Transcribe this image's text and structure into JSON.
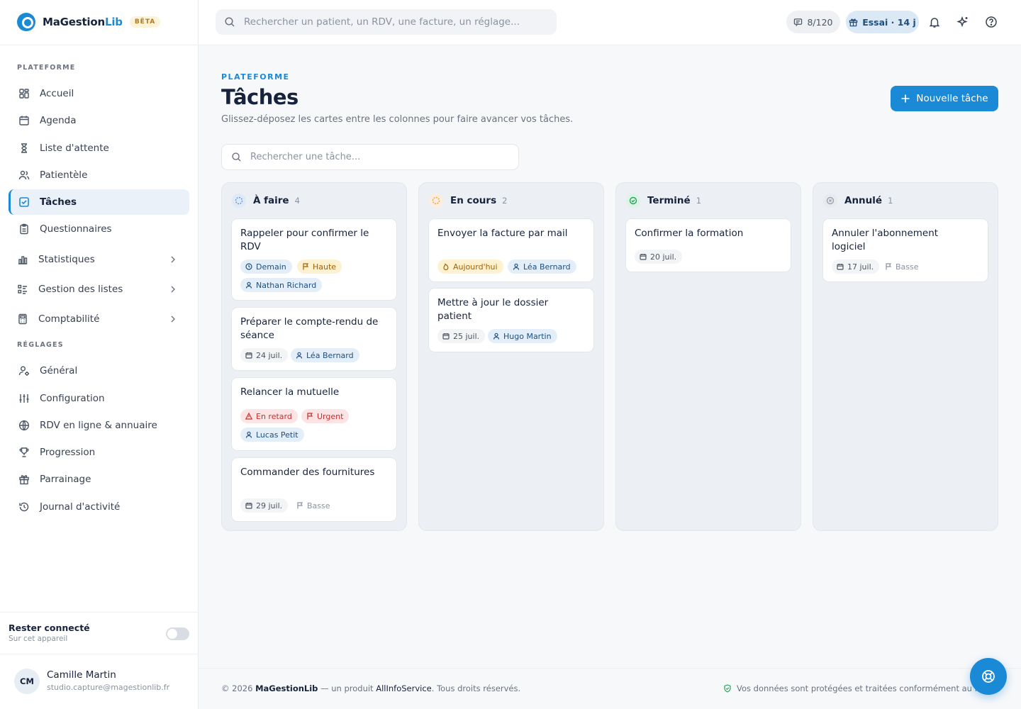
{
  "brand": {
    "name_main": "MaGestion",
    "name_accent": "Lib",
    "badge": "BÊTA"
  },
  "sidebar": {
    "section_platform": "PLATEFORME",
    "section_settings": "RÉGLAGES",
    "items": [
      {
        "label": "Accueil",
        "icon": "grid-icon"
      },
      {
        "label": "Agenda",
        "icon": "calendar-icon"
      },
      {
        "label": "Liste d'attente",
        "icon": "hourglass-icon"
      },
      {
        "label": "Patientèle",
        "icon": "users-icon"
      },
      {
        "label": "Tâches",
        "icon": "checkbox-icon",
        "active": true
      },
      {
        "label": "Questionnaires",
        "icon": "clipboard-icon"
      },
      {
        "label": "Statistiques",
        "icon": "bar-chart-icon",
        "expandable": true
      },
      {
        "label": "Gestion des listes",
        "icon": "list-icon",
        "expandable": true
      },
      {
        "label": "Comptabilité",
        "icon": "calculator-icon",
        "expandable": true
      }
    ],
    "settings_items": [
      {
        "label": "Général",
        "icon": "user-cog-icon"
      },
      {
        "label": "Configuration",
        "icon": "sliders-icon"
      },
      {
        "label": "RDV en ligne & annuaire",
        "icon": "globe-icon"
      },
      {
        "label": "Progression",
        "icon": "trophy-icon"
      },
      {
        "label": "Parrainage",
        "icon": "gift-icon"
      },
      {
        "label": "Journal d'activité",
        "icon": "history-icon"
      }
    ],
    "stay_connected": {
      "title": "Rester connecté",
      "subtitle": "Sur cet appareil",
      "enabled": false
    },
    "user": {
      "initials": "CM",
      "name": "Camille Martin",
      "email": "studio.capture@magestionlib.fr"
    }
  },
  "topbar": {
    "search_placeholder": "Rechercher un patient, un RDV, une facture, un réglage...",
    "sms_counter": "8/120",
    "trial": "Essai · 14 j"
  },
  "page": {
    "eyebrow": "PLATEFORME",
    "title": "Tâches",
    "subtitle": "Glissez-déposez les cartes entre les colonnes pour faire avancer vos tâches.",
    "new_button": "Nouvelle tâche",
    "search_placeholder": "Rechercher une tâche..."
  },
  "columns": [
    {
      "title": "À faire",
      "count": "4",
      "status": "todo",
      "color": "#5b9bd5",
      "cards": [
        {
          "title": "Rappeler pour confirmer le RDV",
          "chips": [
            {
              "text": "Demain"
            },
            {
              "text": "Haute"
            },
            {
              "text": "Nathan Richard"
            }
          ]
        },
        {
          "title": "Préparer le compte-rendu de séance",
          "chips": [
            {
              "text": "24 juil."
            },
            {
              "text": "Léa Bernard"
            }
          ]
        },
        {
          "title": "Relancer la mutuelle",
          "chips": [
            {
              "text": "En retard"
            },
            {
              "text": "Urgent"
            },
            {
              "text": "Lucas Petit"
            }
          ]
        },
        {
          "title": "Commander des fournitures",
          "chips": [
            {
              "text": "29 juil."
            },
            {
              "text": "Basse"
            }
          ]
        }
      ]
    },
    {
      "title": "En cours",
      "count": "2",
      "status": "in-progress",
      "color": "#e8a33d",
      "cards": [
        {
          "title": "Envoyer la facture par mail",
          "chips": [
            {
              "text": "Aujourd'hui"
            },
            {
              "text": "Léa Bernard"
            }
          ]
        },
        {
          "title": "Mettre à jour le dossier patient",
          "chips": [
            {
              "text": "25 juil."
            },
            {
              "text": "Hugo Martin"
            }
          ]
        }
      ]
    },
    {
      "title": "Terminé",
      "count": "1",
      "status": "done",
      "color": "#22a55b",
      "cards": [
        {
          "title": "Confirmer la formation",
          "chips": [
            {
              "text": "20 juil."
            }
          ]
        }
      ]
    },
    {
      "title": "Annulé",
      "count": "1",
      "status": "cancelled",
      "color": "#9ca3af",
      "cards": [
        {
          "title": "Annuler l'abonnement logiciel",
          "chips": [
            {
              "text": "17 juil."
            },
            {
              "text": "Basse"
            }
          ]
        }
      ]
    }
  ],
  "footer": {
    "year": "© 2026",
    "brand": "MaGestionLib",
    "mid": " — un produit ",
    "company": "AllInfoService",
    "end": ". Tous droits réservés.",
    "privacy": "Vos données sont protégées et traitées conformément au RGPD."
  },
  "colors": {
    "accent": "#1b8ad6",
    "text": "#17233c"
  }
}
